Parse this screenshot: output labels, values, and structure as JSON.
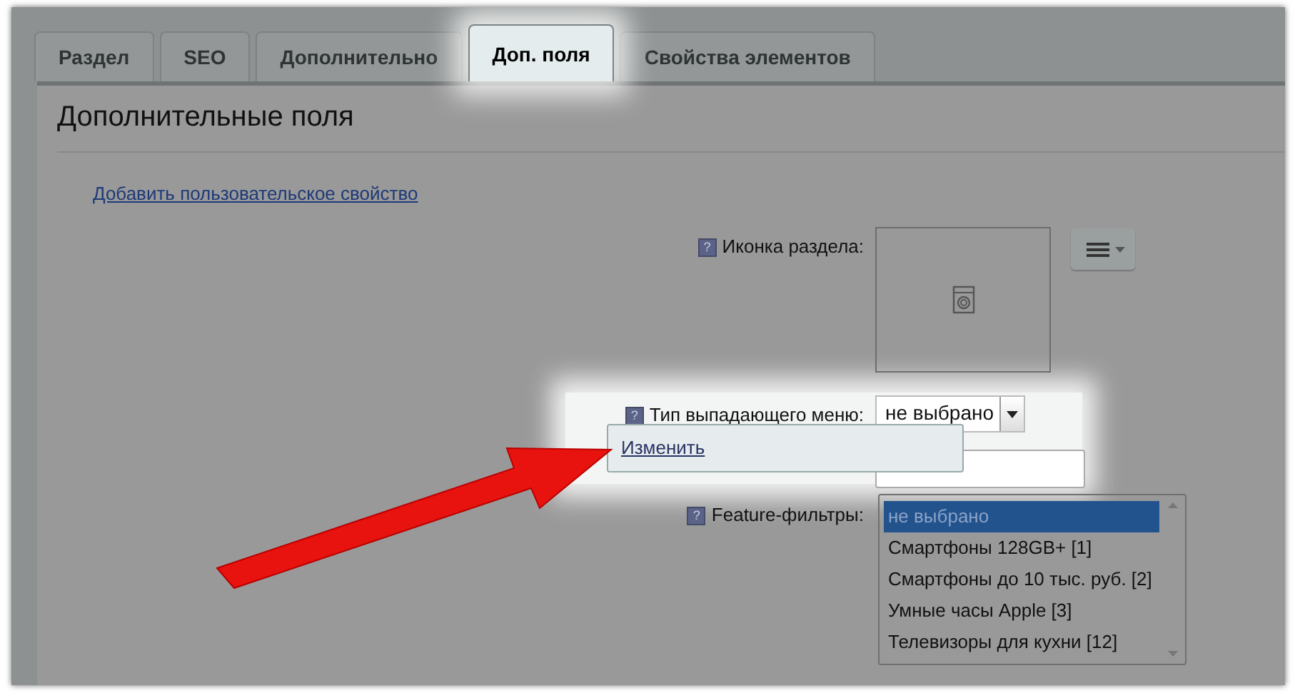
{
  "tabs": [
    {
      "label": "Раздел",
      "selected": false
    },
    {
      "label": "SEO",
      "selected": false
    },
    {
      "label": "Дополнительно",
      "selected": false
    },
    {
      "label": "Доп. поля",
      "selected": true
    },
    {
      "label": "Свойства элементов",
      "selected": false
    }
  ],
  "section_title": "Дополнительные поля",
  "add_property_link": "Добавить пользовательское свойство",
  "fields": [
    {
      "kind": "image",
      "hint": "?",
      "label": "Иконка раздела:"
    },
    {
      "kind": "select",
      "hint": "?",
      "label": "Тип выпадающего меню:",
      "value": "не выбрано"
    },
    {
      "kind": "text"
    },
    {
      "kind": "listbox",
      "hint": "?",
      "label": "Feature-фильтры:",
      "options": [
        {
          "label": "не выбрано",
          "selected": true
        },
        {
          "label": "Смартфоны 128GB+ [1]",
          "selected": false
        },
        {
          "label": "Смартфоны до 10 тыс. руб. [2]",
          "selected": false
        },
        {
          "label": "Умные часы Apple [3]",
          "selected": false
        },
        {
          "label": "Телевизоры для кухни [12]",
          "selected": false
        }
      ]
    }
  ],
  "popup_menu": {
    "items": [
      "Изменить"
    ]
  }
}
